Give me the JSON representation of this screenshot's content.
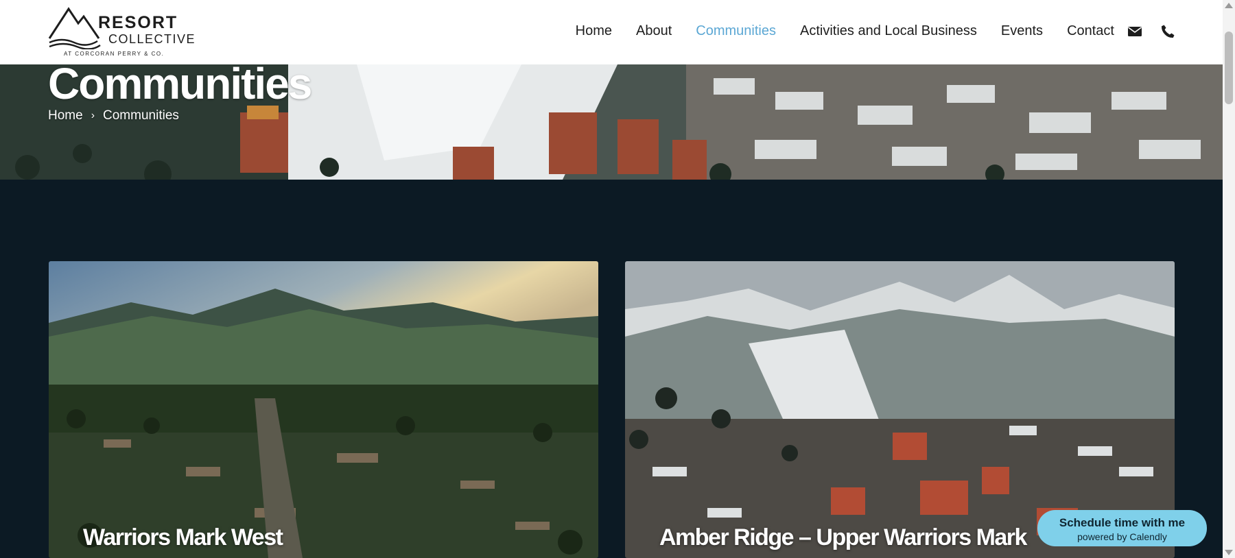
{
  "brand": {
    "name_line1": "RESORT",
    "name_line2": "COLLECTIVE",
    "tagline": "AT CORCORAN PERRY & CO."
  },
  "nav": {
    "items": [
      {
        "label": "Home",
        "active": false
      },
      {
        "label": "About",
        "active": false
      },
      {
        "label": "Communities",
        "active": true
      },
      {
        "label": "Activities and Local Business",
        "active": false
      },
      {
        "label": "Events",
        "active": false
      },
      {
        "label": "Contact",
        "active": false
      }
    ],
    "icons": [
      "envelope-icon",
      "phone-icon"
    ],
    "active_color": "#5ba7d4"
  },
  "hero": {
    "title": "Communities",
    "breadcrumb": {
      "home": "Home",
      "separator": "›",
      "current": "Communities"
    }
  },
  "cards": [
    {
      "title": "Warriors Mark West"
    },
    {
      "title": "Amber Ridge – Upper Warriors Mark"
    }
  ],
  "calendly": {
    "title": "Schedule time with me",
    "subtitle": "powered by Calendly",
    "color": "#7fd0ea"
  },
  "colors": {
    "page_background": "#0c1a24",
    "header_background": "#ffffff"
  }
}
